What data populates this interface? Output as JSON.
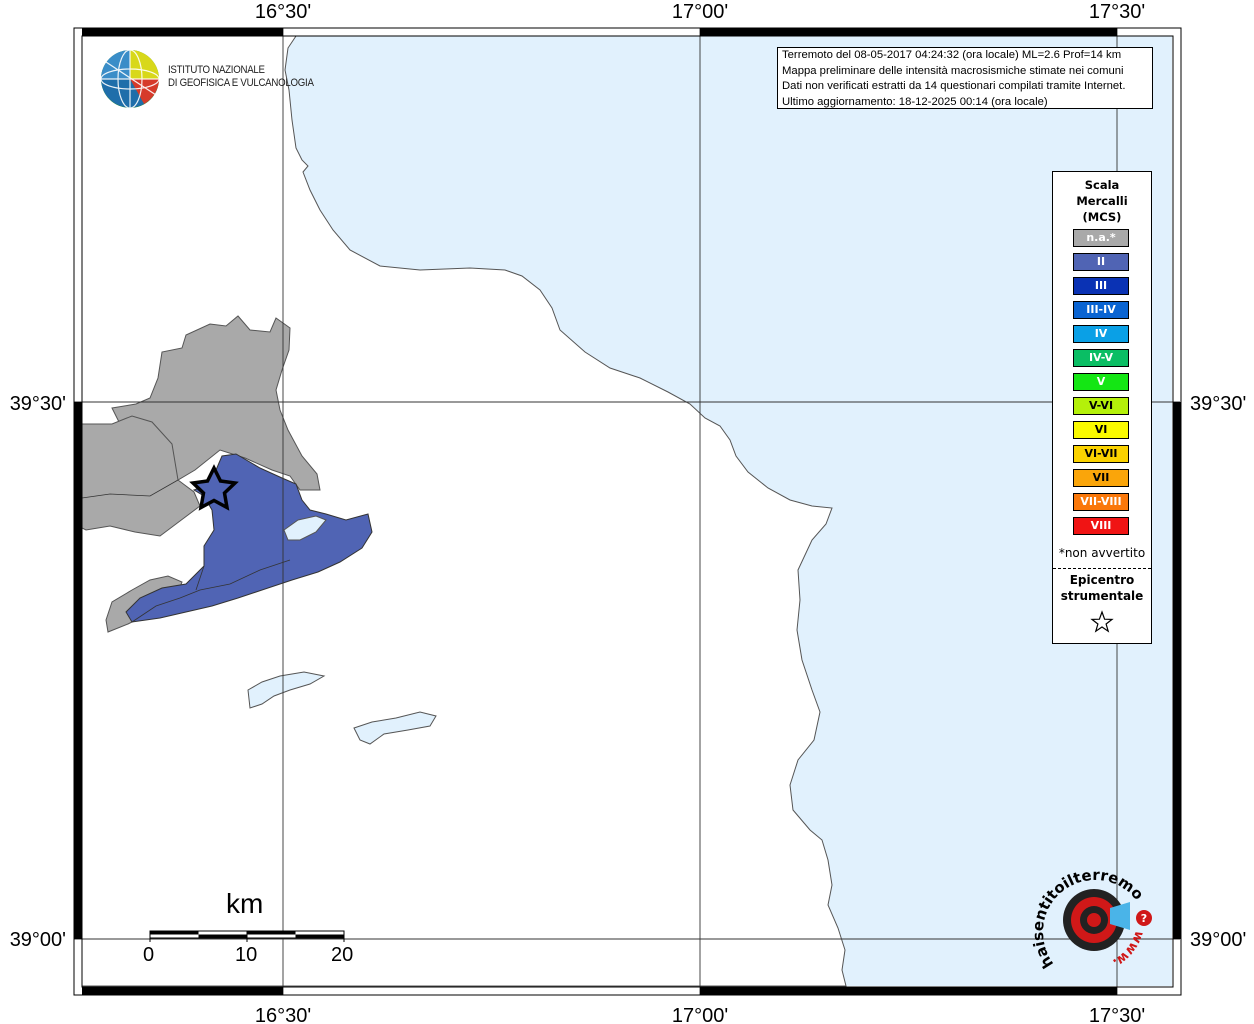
{
  "map": {
    "lon_labels": [
      "16°30'",
      "17°00'",
      "17°30'"
    ],
    "lat_labels": [
      "39°30'",
      "39°00'"
    ],
    "colors": {
      "sea": "#e1f1fd",
      "land": "#ffffff",
      "na": "#a9a9a9",
      "intensity_ii": "#5064b4"
    },
    "epicenter_icon": "star-icon"
  },
  "info_box": {
    "line1": "Terremoto del 08-05-2017 04:24:32 (ora locale) ML=2.6 Prof=14 km",
    "line2": "Mappa preliminare delle intensità macrosismiche stimate nei comuni",
    "line3": "Dati non verificati estratti da 14 questionari compilati tramite Internet.",
    "line4": "Ultimo aggiornamento: 18-12-2025 00:14 (ora locale)"
  },
  "legend": {
    "title1": "Scala",
    "title2": "Mercalli",
    "title3": "(MCS)",
    "items": [
      {
        "label": "n.a.*",
        "color": "#a9a9a9"
      },
      {
        "label": "II",
        "color": "#5064b4"
      },
      {
        "label": "III",
        "color": "#0a32b4"
      },
      {
        "label": "III-IV",
        "color": "#0a64d2"
      },
      {
        "label": "IV",
        "color": "#0aa0e6"
      },
      {
        "label": "IV-V",
        "color": "#0abe64"
      },
      {
        "label": "V",
        "color": "#14e614"
      },
      {
        "label": "V-VI",
        "color": "#b4f00a"
      },
      {
        "label": "VI",
        "color": "#fafa00"
      },
      {
        "label": "VI-VII",
        "color": "#fad200"
      },
      {
        "label": "VII",
        "color": "#faa50a"
      },
      {
        "label": "VII-VIII",
        "color": "#fa780a"
      },
      {
        "label": "VIII",
        "color": "#f01414"
      }
    ],
    "non_avvertito": "*non avvertito",
    "epicentro1": "Epicentro",
    "epicentro2": "strumentale"
  },
  "logo": {
    "ingv_line1": "ISTITUTO NAZIONALE",
    "ingv_line2": "DI GEOFISICA E VULCANOLOGIA",
    "hst_text": "haisentitoilterremoto.it",
    "hst_www": "www."
  },
  "scale_bar": {
    "unit": "km",
    "labels": [
      "0",
      "10",
      "20"
    ]
  }
}
